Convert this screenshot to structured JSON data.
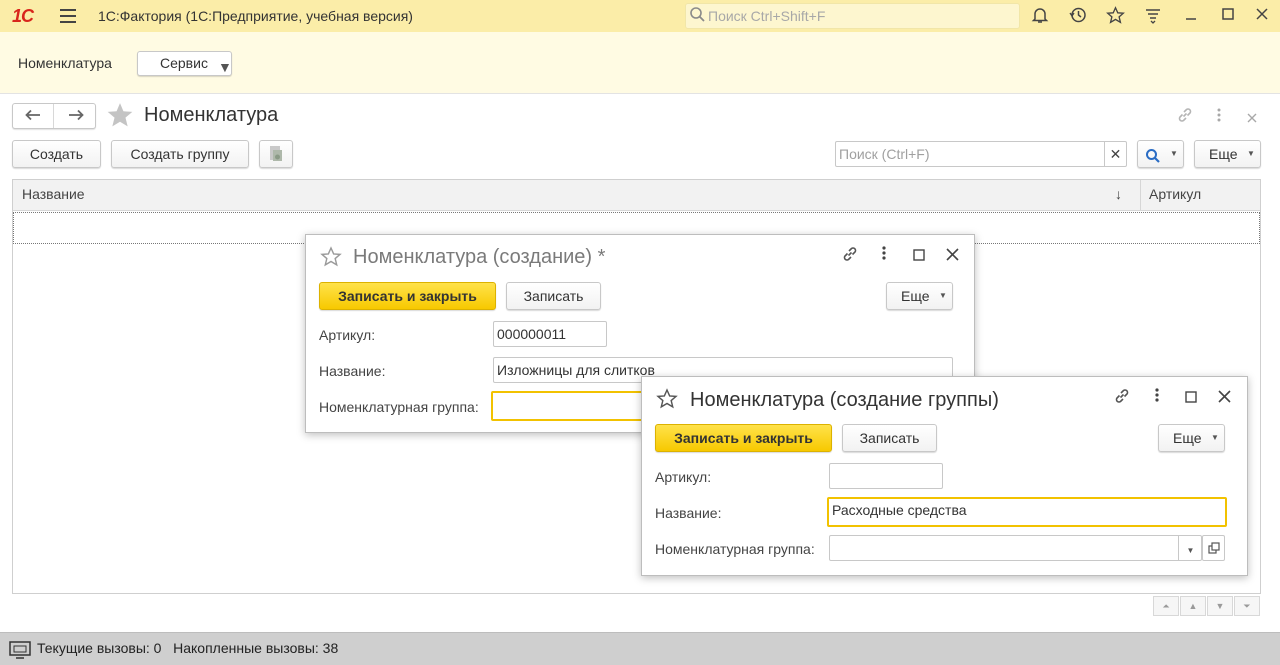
{
  "app": {
    "logo": "1С",
    "title": "1С:Фактория  (1С:Предприятие, учебная версия)",
    "search_placeholder": "Поиск Ctrl+Shift+F"
  },
  "section": {
    "link": "Номенклатура",
    "service_button": "Сервис"
  },
  "main_form": {
    "title": "Номенклатура",
    "create_button": "Создать",
    "create_group_button": "Создать группу",
    "search_placeholder": "Поиск (Ctrl+F)",
    "more_button": "Еще",
    "columns": [
      "Название",
      "Артикул"
    ],
    "sort_indicator": "↓"
  },
  "dialog_item": {
    "title": "Номенклатура (создание) *",
    "save_close_button": "Записать и закрыть",
    "save_button": "Записать",
    "more_button": "Еще",
    "fields": {
      "article_label": "Артикул:",
      "article_value": "000000011",
      "name_label": "Название:",
      "name_value": "Изложницы для слитков",
      "group_label": "Номенклатурная группа:",
      "group_value": ""
    }
  },
  "dialog_group": {
    "title": "Номенклатура (создание группы)",
    "save_close_button": "Записать и закрыть",
    "save_button": "Записать",
    "more_button": "Еще",
    "fields": {
      "article_label": "Артикул:",
      "article_value": "",
      "name_label": "Название:",
      "name_value": "Расходные средства",
      "group_label": "Номенклатурная группа:",
      "group_value": ""
    }
  },
  "status": {
    "text": "Текущие вызовы: 0   Накопленные вызовы: 38"
  },
  "colors": {
    "titlebar": "#fbeda8",
    "accent_yellow": "#f7c900",
    "logo_red": "#d8261c"
  }
}
